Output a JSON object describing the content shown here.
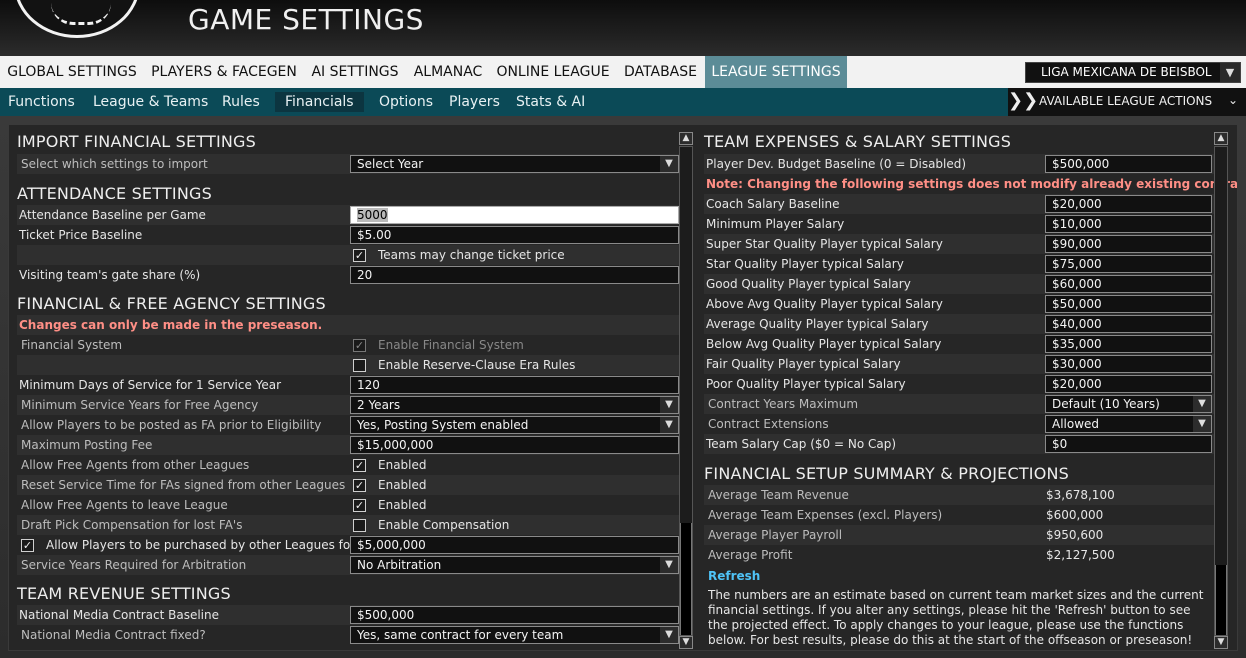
{
  "header": {
    "title": "GAME SETTINGS"
  },
  "topnav": {
    "items": [
      {
        "label": "GLOBAL SETTINGS"
      },
      {
        "label": "PLAYERS & FACEGEN"
      },
      {
        "label": "AI SETTINGS"
      },
      {
        "label": "ALMANAC"
      },
      {
        "label": "ONLINE LEAGUE"
      },
      {
        "label": "DATABASE"
      },
      {
        "label": "LEAGUE SETTINGS",
        "active": true
      }
    ],
    "league_select": "LIGA MEXICANA DE BEISBOL"
  },
  "subnav": {
    "items": [
      {
        "label": "Functions"
      },
      {
        "label": "League & Teams"
      },
      {
        "label": "Rules"
      },
      {
        "label": "Financials",
        "active": true
      },
      {
        "label": "Options"
      },
      {
        "label": "Players"
      },
      {
        "label": "Stats & AI"
      }
    ],
    "actions_label": "AVAILABLE LEAGUE ACTIONS"
  },
  "left": {
    "import": {
      "title": "IMPORT FINANCIAL SETTINGS",
      "label": "Select which settings to import",
      "value": "Select Year"
    },
    "attendance": {
      "title": "ATTENDANCE SETTINGS",
      "baseline_label": "Attendance Baseline per Game",
      "baseline_value": "5000",
      "ticket_label": "Ticket Price Baseline",
      "ticket_value": "$5.00",
      "change_ticket_label": "Teams may change ticket price",
      "gate_label": "Visiting team's gate share (%)",
      "gate_value": "20"
    },
    "fa": {
      "title": "FINANCIAL & FREE AGENCY SETTINGS",
      "warning": "Changes can only be made in the preseason.",
      "fin_system_label": "Financial System",
      "enable_fin_label": "Enable Financial System",
      "reserve_label": "Enable Reserve-Clause Era Rules",
      "min_days_label": "Minimum Days of Service for 1 Service Year",
      "min_days_value": "120",
      "min_years_label": "Minimum Service Years for Free Agency",
      "min_years_value": "2 Years",
      "posting_label": "Allow Players to be posted as FA prior to Eligibility",
      "posting_value": "Yes, Posting System enabled",
      "max_fee_label": "Maximum Posting Fee",
      "max_fee_value": "$15,000,000",
      "fa_other_label": "Allow Free Agents from other Leagues",
      "fa_other_value": "Enabled",
      "reset_label": "Reset Service Time for FAs signed from other Leagues",
      "reset_value": "Enabled",
      "fa_leave_label": "Allow Free Agents to leave League",
      "fa_leave_value": "Enabled",
      "draft_comp_label": "Draft Pick Compensation for lost FA's",
      "draft_comp_value": "Enable Compensation",
      "purchase_label": "Allow Players to be purchased by other Leagues for:",
      "purchase_value": "$5,000,000",
      "arb_label": "Service Years Required for Arbitration",
      "arb_value": "No Arbitration"
    },
    "revenue": {
      "title": "TEAM REVENUE SETTINGS",
      "media_label": "National Media Contract Baseline",
      "media_value": "$500,000",
      "fixed_label": "National Media Contract fixed?",
      "fixed_value": "Yes, same contract for every team"
    }
  },
  "right": {
    "expenses": {
      "title": "TEAM EXPENSES & SALARY SETTINGS",
      "dev_label": "Player Dev. Budget Baseline (0 = Disabled)",
      "dev_value": "$500,000",
      "note": "Note: Changing the following settings does not modify already existing contracts!",
      "rows": [
        {
          "label": "Coach Salary Baseline",
          "value": "$20,000"
        },
        {
          "label": "Minimum Player Salary",
          "value": "$10,000"
        },
        {
          "label": "Super Star Quality Player typical Salary",
          "value": "$90,000"
        },
        {
          "label": "Star Quality Player typical Salary",
          "value": "$75,000"
        },
        {
          "label": "Good Quality Player typical Salary",
          "value": "$60,000"
        },
        {
          "label": "Above Avg Quality Player typical Salary",
          "value": "$50,000"
        },
        {
          "label": "Average Quality Player typical Salary",
          "value": "$40,000"
        },
        {
          "label": "Below Avg Quality Player typical Salary",
          "value": "$35,000"
        },
        {
          "label": "Fair Quality Player typical Salary",
          "value": "$30,000"
        },
        {
          "label": "Poor Quality Player typical Salary",
          "value": "$20,000"
        }
      ],
      "contract_years_label": "Contract Years Maximum",
      "contract_years_value": "Default (10 Years)",
      "extensions_label": "Contract Extensions",
      "extensions_value": "Allowed",
      "cap_label": "Team Salary Cap ($0 = No Cap)",
      "cap_value": "$0"
    },
    "summary": {
      "title": "FINANCIAL SETUP SUMMARY & PROJECTIONS",
      "rows": [
        {
          "label": "Average Team Revenue",
          "value": "$3,678,100"
        },
        {
          "label": "Average Team Expenses (excl. Players)",
          "value": "$600,000"
        },
        {
          "label": "Average Player Payroll",
          "value": "$950,600"
        },
        {
          "label": "Average Profit",
          "value": "$2,127,500"
        }
      ],
      "refresh_label": "Refresh",
      "note": "The numbers are an estimate based on current team market sizes and the current financial settings. If you alter any settings, please hit the 'Refresh' button to see the projected effect. To apply changes to your league, please use the functions below. For best results, please do this at the start of the offseason or preseason!"
    }
  }
}
